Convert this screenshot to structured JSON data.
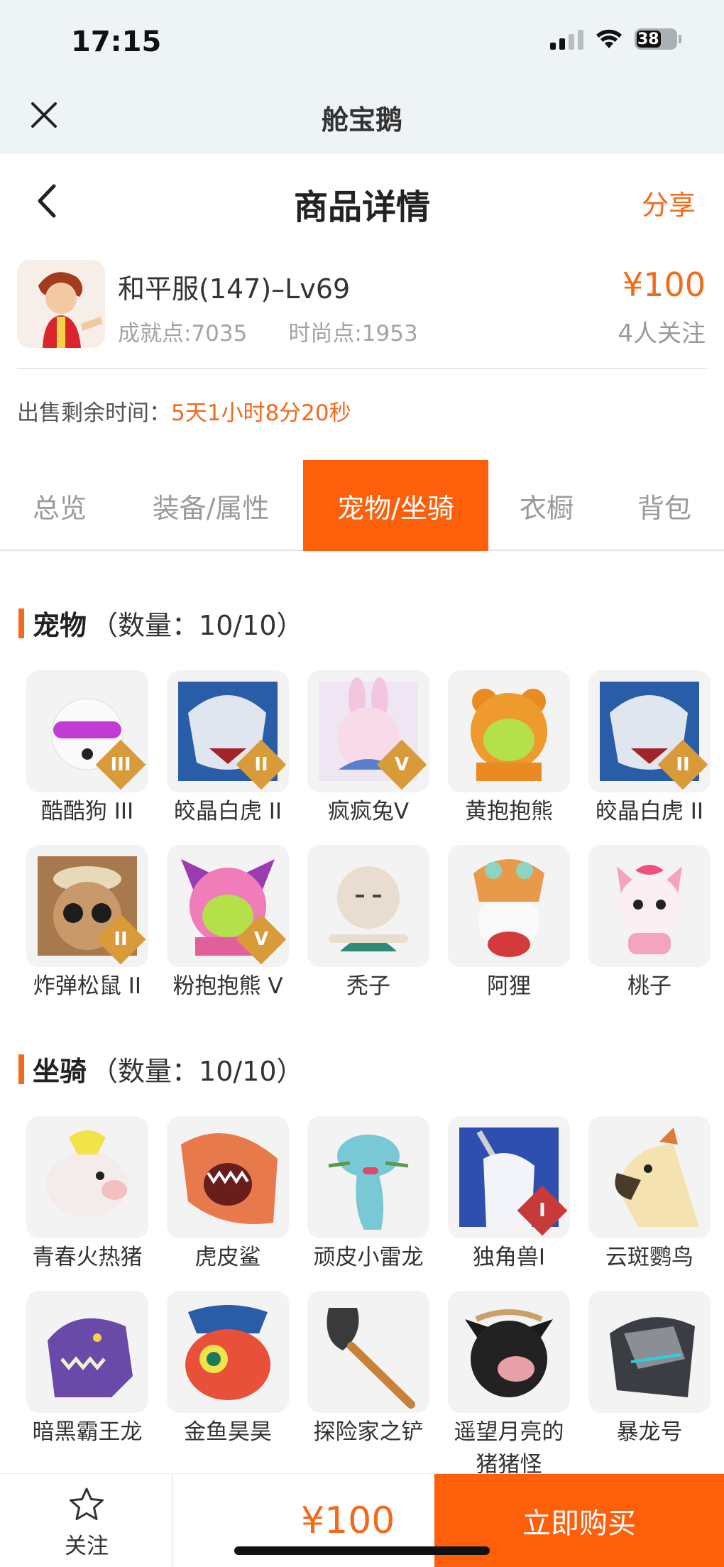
{
  "status_bar": {
    "time": "17:15",
    "battery": "38"
  },
  "webview": {
    "title": "舱宝鹅"
  },
  "header": {
    "title": "商品详情",
    "share": "分享"
  },
  "product": {
    "name": "和平服(147)–Lv69",
    "achievement": "成就点:7035",
    "fashion": "时尚点:1953",
    "price": "¥100",
    "followers": "4人关注"
  },
  "timer": {
    "label": "出售剩余时间：",
    "value": "5天1小时8分20秒"
  },
  "tabs": [
    {
      "label": "总览"
    },
    {
      "label": "装备/属性"
    },
    {
      "label": "宠物/坐骑"
    },
    {
      "label": "衣橱"
    },
    {
      "label": "背包"
    }
  ],
  "active_tab": "宠物/坐骑",
  "pets": {
    "title": "宠物",
    "count": "（数量：10/10）",
    "items": [
      {
        "name": "酷酷狗 III",
        "badge": "III"
      },
      {
        "name": "皎晶白虎 II",
        "badge": "II"
      },
      {
        "name": "疯疯兔V",
        "badge": "V"
      },
      {
        "name": "黄抱抱熊",
        "badge": ""
      },
      {
        "name": "皎晶白虎 II",
        "badge": "II"
      },
      {
        "name": "炸弹松鼠 II",
        "badge": "II"
      },
      {
        "name": "粉抱抱熊 V",
        "badge": "V"
      },
      {
        "name": "秃子",
        "badge": ""
      },
      {
        "name": "阿狸",
        "badge": ""
      },
      {
        "name": "桃子",
        "badge": ""
      }
    ]
  },
  "mounts": {
    "title": "坐骑",
    "count": "（数量：10/10）",
    "items": [
      {
        "name": "青春火热猪",
        "badge": ""
      },
      {
        "name": "虎皮鲨",
        "badge": ""
      },
      {
        "name": "顽皮小雷龙",
        "badge": ""
      },
      {
        "name": "独角兽I",
        "badge": "I"
      },
      {
        "name": "云斑鹦鸟",
        "badge": ""
      },
      {
        "name": "暗黑霸王龙",
        "badge": ""
      },
      {
        "name": "金鱼昊昊",
        "badge": ""
      },
      {
        "name": "探险家之铲",
        "badge": ""
      },
      {
        "name": "遥望月亮的猪猪怪",
        "badge": ""
      },
      {
        "name": "暴龙号",
        "badge": ""
      }
    ]
  },
  "bottom": {
    "follow": "关注",
    "price": "¥100",
    "buy": "立即购买"
  },
  "colors": {
    "accent": "#fd5f0a",
    "price": "#f26a1b",
    "badge_gold": "#d99a3a",
    "badge_red": "#c83a3a"
  }
}
